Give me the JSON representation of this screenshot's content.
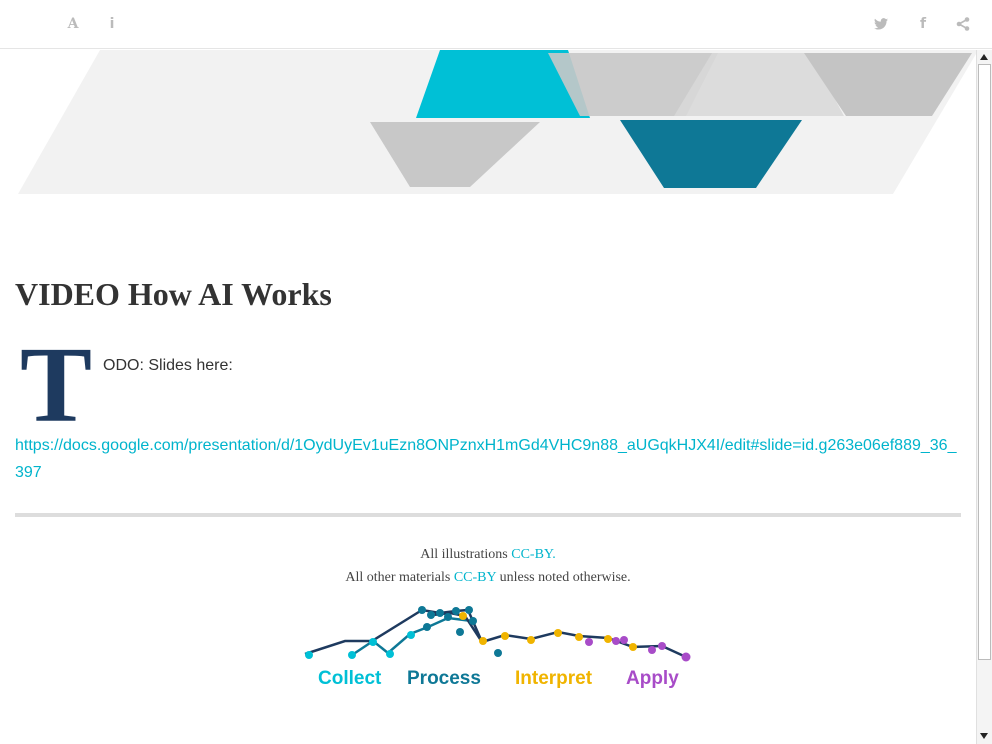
{
  "toolbar": {
    "font_icon_glyph": "A",
    "info_icon_glyph": "i",
    "facebook_icon_glyph": "f"
  },
  "article": {
    "title": "VIDEO How AI Works",
    "dropcap": "T",
    "lead_text": "ODO: Slides here:",
    "link": "https://docs.google.com/presentation/d/1OydUyEv1uEzn8ONPznxH1mGd4VHC9n88_aUGqkHJX4I/edit#slide=id.g263e06ef889_36_397"
  },
  "footer": {
    "line1_prefix": "All illustrations",
    "line1_link": "CC-BY.",
    "line2_prefix": "All other materials",
    "line2_link": "CC-BY",
    "line2_suffix": "unless noted otherwise."
  },
  "logo": {
    "labels": [
      "Collect",
      "Process",
      "Interpret",
      "Apply"
    ]
  },
  "colors": {
    "accent_cyan": "#00c0d6",
    "dark_teal": "#0e7896",
    "navy": "#1e3a5f",
    "yellow": "#f0b400",
    "purple": "#a84cc8",
    "gray_shape": "#c8c8c8",
    "link": "#00b4cc"
  }
}
